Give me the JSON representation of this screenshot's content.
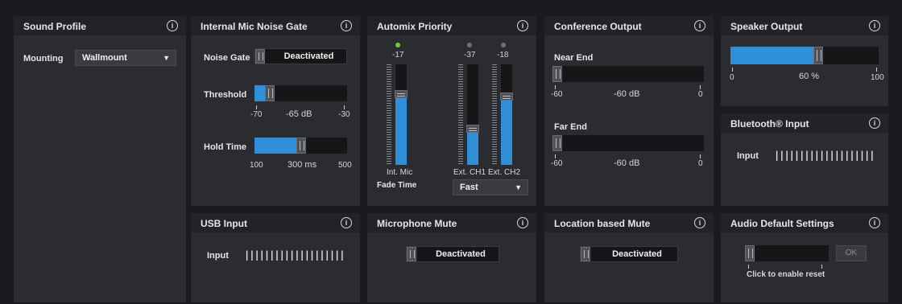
{
  "sound_profile": {
    "title": "Sound Profile",
    "mounting_label": "Mounting",
    "mounting_value": "Wallmount"
  },
  "noise_gate": {
    "title": "Internal Mic Noise Gate",
    "gate_label": "Noise Gate",
    "gate_state": "Deactivated",
    "threshold_label": "Threshold",
    "threshold_value": "-65 dB",
    "threshold_min": "-70",
    "threshold_max": "-30",
    "threshold_level": 0.125,
    "hold_label": "Hold Time",
    "hold_value": "300 ms",
    "hold_min": "100",
    "hold_max": "500",
    "hold_level": 0.5
  },
  "automix": {
    "title": "Automix Priority",
    "channels": [
      {
        "name": "Int. Mic",
        "value": "-17",
        "active": true,
        "level": 0.72
      },
      {
        "name": "Ext. CH1",
        "value": "-37",
        "active": false,
        "level": 0.35
      },
      {
        "name": "Ext. CH2",
        "value": "-18",
        "active": false,
        "level": 0.7
      }
    ],
    "fade_label": "Fade Time",
    "fade_value": "Fast"
  },
  "conference": {
    "title": "Conference Output",
    "near_label": "Near End",
    "near_value": "-60 dB",
    "near_min": "-60",
    "near_max": "0",
    "far_label": "Far End",
    "far_value": "-60 dB",
    "far_min": "-60",
    "far_max": "0"
  },
  "speaker": {
    "title": "Speaker Output",
    "value": "60 %",
    "min": "0",
    "max": "100",
    "level": 0.6
  },
  "bluetooth": {
    "title": "Bluetooth® Input",
    "input_label": "Input",
    "meter": "||||||||||||||||||||"
  },
  "usb": {
    "title": "USB Input",
    "input_label": "Input",
    "meter": "||||||||||||||||||||"
  },
  "mic_mute": {
    "title": "Microphone Mute",
    "state": "Deactivated"
  },
  "location_mute": {
    "title": "Location based Mute",
    "state": "Deactivated"
  },
  "audio_default": {
    "title": "Audio Default Settings",
    "ok_label": "OK",
    "hint": "Click to enable reset"
  },
  "info_glyph": "i",
  "colors": {
    "accent": "#2f8fd8",
    "active_led": "#6fd23a",
    "idle_led": "#6e7075"
  }
}
